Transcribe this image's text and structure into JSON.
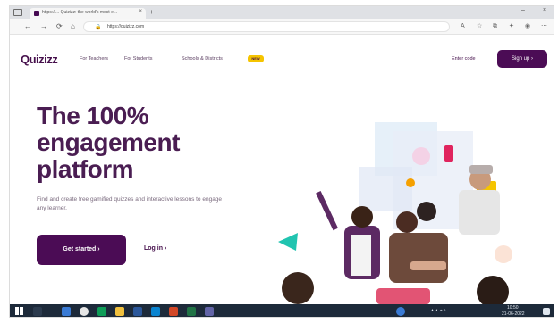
{
  "browser": {
    "tab_title": "https://... Quizizz: the world's most e...",
    "tab_close": "×",
    "new_tab": "+",
    "window_controls": [
      "–",
      "×"
    ],
    "url": "https://quizizz.com",
    "nav": {
      "back": "←",
      "forward": "→",
      "reload": "⟳",
      "home": "⌂"
    }
  },
  "site_nav": {
    "logo": "Quizizz",
    "links": [
      "For Teachers",
      "For Students",
      "Schools & Districts"
    ],
    "badge": "NEW",
    "enter_code": "Enter code",
    "signup": "Sign up ›"
  },
  "hero": {
    "title": "The 100% engagement platform",
    "subtitle": "Find and create free gamified quizzes and interactive lessons to engage any learner.",
    "cta": "Get started ›",
    "login": "Log in ›"
  },
  "taskbar": {
    "time": "10:50",
    "date": "21-06-2022"
  },
  "colors": {
    "brand_purple": "#4b0c55",
    "accent_yellow": "#f5c400",
    "accent_teal": "#21c4b0",
    "accent_red": "#e0245e"
  }
}
